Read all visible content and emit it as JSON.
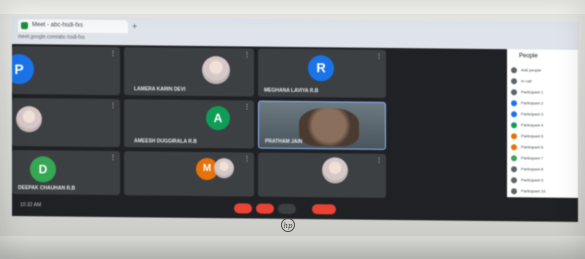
{
  "browser": {
    "tab_title": "Meet - abc-hsdi-fxs",
    "newtab_label": "+",
    "address": "meet.google.com/abc-hsdi-fxs"
  },
  "tiles": [
    {
      "id": "p1",
      "initial": "P",
      "name": "",
      "color": "#1a73e8"
    },
    {
      "id": "p2",
      "initial": "",
      "name": "",
      "color": ""
    },
    {
      "id": "p3",
      "initial": "",
      "name": "LAMERA KARIN DEVI",
      "color": ""
    },
    {
      "id": "p4",
      "initial": "R",
      "name": "MEGHANA LAVIYA R.B",
      "color": "#1a73e8"
    },
    {
      "id": "p5",
      "initial": "",
      "name": "",
      "color": ""
    },
    {
      "id": "p6",
      "initial": "A",
      "name": "AMEESH DUGGIRALA R.B",
      "color": "#0f9d58"
    },
    {
      "id": "p7",
      "initial": "",
      "name": "PRATHAM JAIN",
      "color": ""
    },
    {
      "id": "p8",
      "initial": "D",
      "name": "DEEPAK CHAUHAN R.B",
      "color": "#34a853"
    },
    {
      "id": "p9",
      "initial": "M",
      "name": "",
      "color": "#e8710a"
    },
    {
      "id": "p10",
      "initial": "",
      "name": "",
      "color": ""
    }
  ],
  "panel": {
    "title": "People",
    "rows": [
      {
        "label": "Add people",
        "color": "#5f6368"
      },
      {
        "label": "In call",
        "color": "#5f6368"
      },
      {
        "label": "Participant 1",
        "color": "#5f6368"
      },
      {
        "label": "Participant 2",
        "color": "#1a73e8"
      },
      {
        "label": "Participant 3",
        "color": "#1a73e8"
      },
      {
        "label": "Participant 4",
        "color": "#0f9d58"
      },
      {
        "label": "Participant 5",
        "color": "#e8710a"
      },
      {
        "label": "Participant 6",
        "color": "#e8710a"
      },
      {
        "label": "Participant 7",
        "color": "#34a853"
      },
      {
        "label": "Participant 8",
        "color": "#5f6368"
      },
      {
        "label": "Participant 9",
        "color": "#5f6368"
      },
      {
        "label": "Participant 10",
        "color": "#5f6368"
      }
    ]
  },
  "controls": {
    "time": "10:32 AM"
  },
  "laptop": {
    "logo": "hp"
  }
}
